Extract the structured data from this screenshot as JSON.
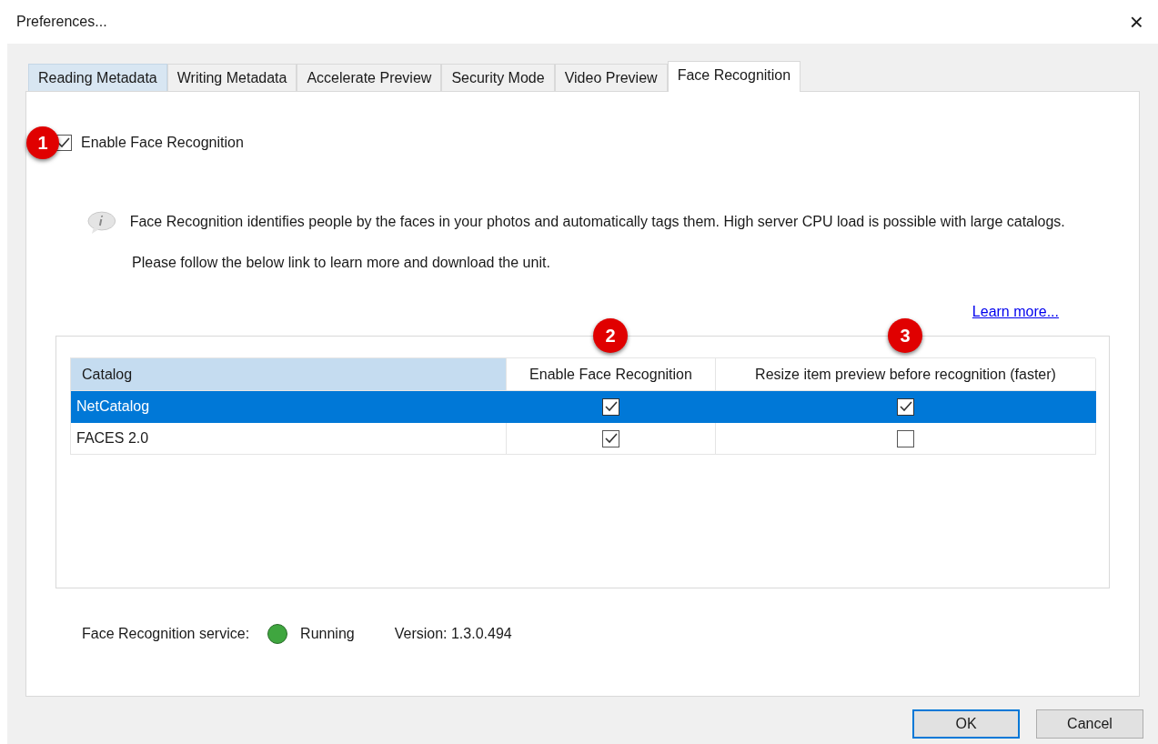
{
  "window": {
    "title": "Preferences...",
    "close": "×"
  },
  "tabs": [
    {
      "label": "Reading Metadata",
      "selected": false,
      "highlighted": true
    },
    {
      "label": "Writing Metadata",
      "selected": false,
      "highlighted": false
    },
    {
      "label": "Accelerate Preview",
      "selected": false,
      "highlighted": false
    },
    {
      "label": "Security Mode",
      "selected": false,
      "highlighted": false
    },
    {
      "label": "Video Preview",
      "selected": false,
      "highlighted": false
    },
    {
      "label": "Face Recognition",
      "selected": true,
      "highlighted": false
    }
  ],
  "enable_checkbox": {
    "label": "Enable Face Recognition",
    "checked": true,
    "callout": "1"
  },
  "info_text": "Face Recognition identifies people by the faces in your photos and automatically tags them. High server CPU load is possible with large catalogs.",
  "follow_text": "Please follow the below link to learn more and download the unit.",
  "learn_more_link": "Learn more...",
  "table": {
    "columns": [
      {
        "label": "Catalog",
        "selected": true
      },
      {
        "label": "Enable Face Recognition",
        "selected": false,
        "callout": "2"
      },
      {
        "label": "Resize item preview before recognition (faster)",
        "selected": false,
        "callout": "3"
      }
    ],
    "rows": [
      {
        "catalog": "NetCatalog",
        "enable": true,
        "resize": true,
        "selected": true
      },
      {
        "catalog": "FACES 2.0",
        "enable": true,
        "resize": false,
        "selected": false
      }
    ]
  },
  "status": {
    "label": "Face Recognition service:",
    "color": "#3fa63f",
    "state": "Running",
    "version": "Version: 1.3.0.494"
  },
  "buttons": [
    {
      "label": "OK",
      "default": true
    },
    {
      "label": "Cancel",
      "default": false
    }
  ]
}
